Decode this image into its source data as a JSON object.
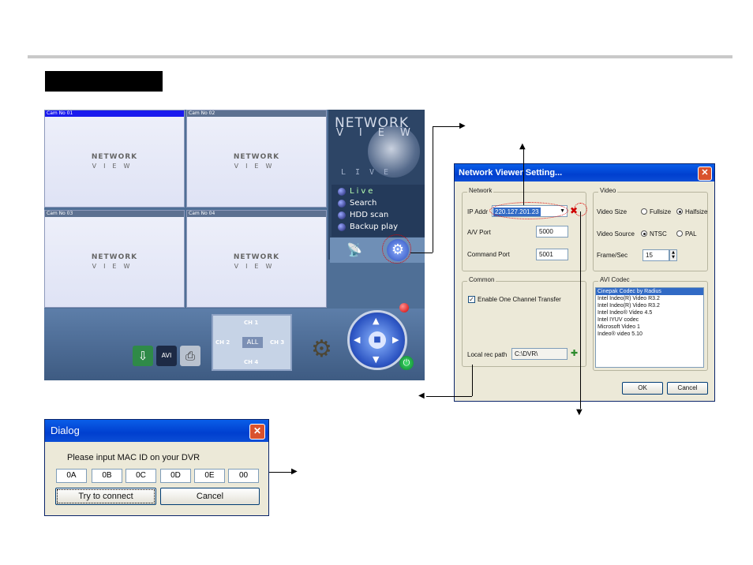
{
  "viewer": {
    "cams": [
      {
        "label": "Cam No 01",
        "logo_line1": "NETWORK",
        "logo_line2": "VIEW"
      },
      {
        "label": "Cam No 02",
        "logo_line1": "NETWORK",
        "logo_line2": "VIEW"
      },
      {
        "label": "Cam No 03",
        "logo_line1": "NETWORK",
        "logo_line2": "VIEW"
      },
      {
        "label": "Cam No 04",
        "logo_line1": "NETWORK",
        "logo_line2": "VIEW"
      }
    ],
    "brand_line1": "NETWORK",
    "brand_line2": "VIEW",
    "lens_letters": "LIVE",
    "menu": [
      "Live",
      "Search",
      "HDD scan",
      "Backup play"
    ],
    "channels": {
      "ch1": "CH 1",
      "ch2": "CH 2",
      "ch3": "CH 3",
      "ch4": "CH 4",
      "all": "ALL"
    },
    "tools": {
      "avi": "AVI"
    }
  },
  "settings": {
    "title": "Network Viewer Setting...",
    "network": {
      "group": "Network",
      "ip_label": "IP Addr",
      "ip_value": "220.127.201.23",
      "av_label": "A/V Port",
      "av_value": "5000",
      "cmd_label": "Command Port",
      "cmd_value": "5001"
    },
    "video": {
      "group": "Video",
      "size_label": "Video Size",
      "fullsize": "Fullsize",
      "halfsize": "Halfsize",
      "source_label": "Video Source",
      "ntsc": "NTSC",
      "pal": "PAL",
      "fps_label": "Frame/Sec",
      "fps_value": "15"
    },
    "common": {
      "group": "Common",
      "enable_label": "Enable One Channel Transfer",
      "rec_label": "Local rec path",
      "rec_value": "C:\\DVR\\"
    },
    "codec": {
      "group": "AVI Codec",
      "items": [
        "Cinepak Codec by Radius",
        "Intel Indeo(R) Video R3.2",
        "Intel Indeo(R) Video R3.2",
        "Intel Indeo® Video 4.5",
        "Intel IYUV codec",
        "Microsoft Video 1",
        "Indeo® video 5.10"
      ]
    },
    "ok": "OK",
    "cancel": "Cancel"
  },
  "dialog": {
    "title": "Dialog",
    "prompt": "Please input MAC ID on your DVR",
    "mac": [
      "0A",
      "0B",
      "0C",
      "0D",
      "0E",
      "00"
    ],
    "connect": "Try to connect",
    "cancel": "Cancel"
  }
}
